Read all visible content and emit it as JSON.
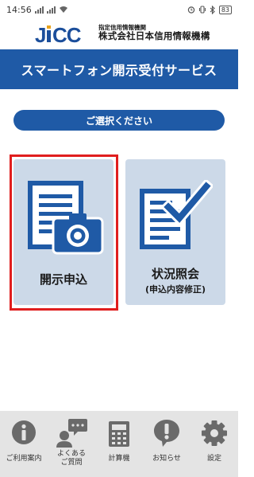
{
  "status_bar": {
    "time": "14:56",
    "battery": "83"
  },
  "header": {
    "logo_text": "JICC",
    "org_sub": "指定信用情報機関",
    "org_main": "株式会社日本信用情報機構"
  },
  "title": "スマートフォン開示受付サービス",
  "select_prompt": "ご選択ください",
  "cards": {
    "apply": {
      "label": "開示申込",
      "icon": "document-camera-icon"
    },
    "status": {
      "label": "状況照会",
      "sublabel": "(申込内容修正)",
      "icon": "document-check-icon"
    }
  },
  "bottom_nav": {
    "items": [
      {
        "label": "ご利用案内",
        "icon": "info-icon"
      },
      {
        "label": "よくある\nご質問",
        "label1": "よくある",
        "label2": "ご質問",
        "icon": "faq-chat-icon"
      },
      {
        "label": "計算機",
        "icon": "calculator-icon"
      },
      {
        "label": "お知らせ",
        "icon": "notice-icon"
      },
      {
        "label": "設定",
        "icon": "gear-icon"
      }
    ]
  },
  "colors": {
    "brand_blue": "#1f5aa6",
    "card_bg": "#ccd9e8",
    "highlight_red": "#e01e1e",
    "nav_bg": "#e4e4e4",
    "icon_gray": "#6a6a6a"
  }
}
